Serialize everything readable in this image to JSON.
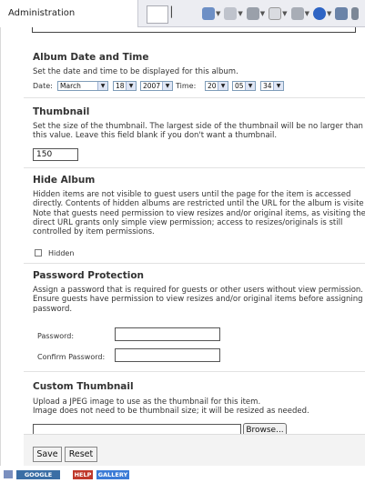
{
  "tab": {
    "title": "Administration"
  },
  "toolbar": {
    "icons": [
      "home-icon",
      "feeds-icon",
      "print-icon",
      "page-icon",
      "tools-icon",
      "help-icon",
      "research-icon",
      "more-icon"
    ]
  },
  "album_date": {
    "heading": "Album Date and Time",
    "description": "Set the date and time to be displayed for this album.",
    "date_label": "Date:",
    "month": "March",
    "day": "18",
    "year": "2007",
    "time_label": "Time:",
    "hour": "20",
    "minute": "05",
    "second": "34"
  },
  "thumbnail": {
    "heading": "Thumbnail",
    "description": "Set the size of the thumbnail. The largest side of the thumbnail will be no larger than\nthis value. Leave this field blank if you don't want a thumbnail.",
    "size_value": "150"
  },
  "hide_album": {
    "heading": "Hide Album",
    "description": "Hidden items are not visible to guest users until the page for the item is accessed\ndirectly. Contents of hidden albums are restricted until the URL for the album is visite\nNote that guests need permission to view resizes and/or original items, as visiting the\ndirect URL grants only simple view permission; access to resizes/originals is still\ncontrolled by item permissions.",
    "checkbox_label": "Hidden"
  },
  "password": {
    "heading": "Password Protection",
    "description": "Assign a password that is required for guests or other users without view permission.\nEnsure guests have permission to view resizes and/or original items before assigning\npassword.",
    "password_label": "Password:",
    "confirm_label": "Confirm Password:"
  },
  "custom_thumb": {
    "heading": "Custom Thumbnail",
    "description": "Upload a JPEG image to use as the thumbnail for this item.\nImage does not need to be thumbnail size; it will be resized as needed.",
    "browse_label": "Browse..."
  },
  "actions": {
    "save": "Save",
    "reset": "Reset"
  },
  "status": {
    "badges": [
      {
        "text": "GOOGLE",
        "color": "#3a6ea5"
      },
      {
        "text": "HELP",
        "color": "#c0392b"
      },
      {
        "text": "GALLERY",
        "color": "#3b7bd6"
      }
    ]
  }
}
